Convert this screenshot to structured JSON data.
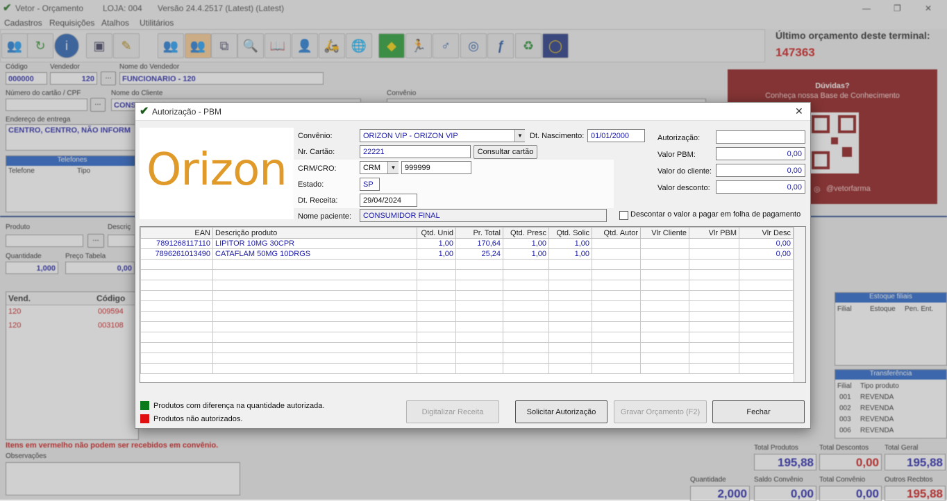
{
  "window": {
    "title": "Vetor - Orçamento",
    "store": "LOJA: 004",
    "version": "Versão 24.4.2517 (Latest) (Latest)",
    "minimize": "—",
    "restore": "❐",
    "close": "✕"
  },
  "menu": [
    "Cadastros",
    "Requisições",
    "Atalhos",
    "Utilitários"
  ],
  "toolbar_icons": [
    "add-client-icon",
    "refresh-icon",
    "info-icon",
    "save-icon",
    "edit-icon",
    "users-icon",
    "users-active-icon",
    "copy-icon",
    "search-icon",
    "book-icon",
    "person-icon",
    "courier-icon",
    "web-icon",
    "brazil-flag-icon",
    "runner-icon",
    "gender-icon",
    "orbit-icon",
    "f-logo-icon",
    "recycle-icon",
    "ring-icon"
  ],
  "last_quote": {
    "label": "Último orçamento deste terminal:",
    "value": "147363"
  },
  "help_panel": {
    "title": "Dúvidas?",
    "subtitle": "Conheça nossa Base de Conhecimento",
    "handle": "@vetorfarma"
  },
  "main": {
    "codigo_label": "Código",
    "codigo": "000000",
    "vendedor_label": "Vendedor",
    "vendedor": "120",
    "vendedor_btn": "...",
    "nome_vendedor_label": "Nome do Vendedor",
    "nome_vendedor": "FUNCIONARIO - 120",
    "cartao_label": "Número do cartão / CPF",
    "cartao_btn": "...",
    "cliente_label": "Nome do Cliente",
    "cliente": "CONSUMIDOR FINAL",
    "convenio_label": "Convênio",
    "endereco_label": "Endereço de entrega",
    "endereco": "CENTRO, CENTRO, NÃO INFORM",
    "telefones_title": "Telefones",
    "tel_col1": "Telefone",
    "tel_col2": "Tipo",
    "produto_label": "Produto",
    "descricao_label": "Descriç",
    "produto_btn": "...",
    "quantidade_label": "Quantidade",
    "quantidade": "1,000",
    "preco_label": "Preço Tabela",
    "preco": "0,00",
    "vend_col": "Vend.",
    "codigo_col": "Código",
    "items": [
      {
        "vend": "120",
        "codigo": "009594"
      },
      {
        "vend": "120",
        "codigo": "003108"
      }
    ],
    "warning": "Itens em vermelho não podem ser recebidos em convênio.",
    "observacoes_label": "Observações",
    "estoque_title": "Estoque filiais",
    "estoque_cols": [
      "Filial",
      "Estoque",
      "Pen. Ent."
    ],
    "transferencia_title": "Transferência",
    "transf_cols": [
      "Filial",
      "Tipo produto"
    ],
    "transf_rows": [
      {
        "filial": "001",
        "tipo": "REVENDA"
      },
      {
        "filial": "002",
        "tipo": "REVENDA"
      },
      {
        "filial": "003",
        "tipo": "REVENDA"
      },
      {
        "filial": "006",
        "tipo": "REVENDA"
      }
    ],
    "totals": {
      "total_produtos_label": "Total Produtos",
      "total_produtos": "195,88",
      "total_descontos_label": "Total Descontos",
      "total_descontos": "0,00",
      "total_geral_label": "Total Geral",
      "total_geral": "195,88",
      "quantidade_label": "Quantidade",
      "quantidade": "2,000",
      "saldo_convenio_label": "Saldo Convênio",
      "saldo_convenio": "0,00",
      "total_convenio_label": "Total Convênio",
      "total_convenio": "0,00",
      "outros_label": "Outros Recbtos",
      "outros": "195,88"
    }
  },
  "dialog": {
    "title": "Autorização - PBM",
    "close": "✕",
    "logo": "Orizon",
    "convenio_label": "Convênio:",
    "convenio": "ORIZON VIP - ORIZON VIP",
    "nascimento_label": "Dt. Nascimento:",
    "nascimento": "01/01/2000",
    "cartao_label": "Nr. Cartão:",
    "cartao": "22221",
    "consultar_btn": "Consultar cartão",
    "crm_label": "CRM/CRO:",
    "crm_type": "CRM",
    "crm_number": "999999",
    "estado_label": "Estado:",
    "estado": "SP",
    "receita_label": "Dt. Receita:",
    "receita": "29/04/2024",
    "paciente_label": "Nome paciente:",
    "paciente": "CONSUMIDOR FINAL",
    "autorizacao_label": "Autorização:",
    "autorizacao": "",
    "valor_pbm_label": "Valor PBM:",
    "valor_pbm": "0,00",
    "valor_cliente_label": "Valor do cliente:",
    "valor_cliente": "0,00",
    "valor_desconto_label": "Valor desconto:",
    "valor_desconto": "0,00",
    "descontar_label": "Descontar o valor a pagar em folha de pagamento",
    "columns": [
      "EAN",
      "Descrição produto",
      "Qtd. Unid",
      "Pr. Total",
      "Qtd. Presc",
      "Qtd. Solic",
      "Qtd. Autor",
      "Vlr Cliente",
      "Vlr PBM",
      "Vlr Desc"
    ],
    "rows": [
      {
        "ean": "7891268117110",
        "descricao": "LIPITOR 10MG 30CPR",
        "qtd_unid": "1,00",
        "pr_total": "170,64",
        "qtd_presc": "1,00",
        "qtd_solic": "1,00",
        "qtd_autor": "",
        "vlr_cliente": "",
        "vlr_pbm": "",
        "vlr_desc": "0,00"
      },
      {
        "ean": "7896261013490",
        "descricao": "CATAFLAM 50MG 10DRGS",
        "qtd_unid": "1,00",
        "pr_total": "25,24",
        "qtd_presc": "1,00",
        "qtd_solic": "1,00",
        "qtd_autor": "",
        "vlr_cliente": "",
        "vlr_pbm": "",
        "vlr_desc": "0,00"
      }
    ],
    "legend_green": "Produtos com diferença na quantidade autorizada.",
    "legend_red": "Produtos não autorizados.",
    "legend_green_color": "#0a7a1a",
    "legend_red_color": "#e01010",
    "btn_digitalizar": "Digitalizar Receita",
    "btn_solicitar": "Solicitar Autorização",
    "btn_gravar": "Gravar Orçamento (F2)",
    "btn_fechar": "Fechar"
  }
}
